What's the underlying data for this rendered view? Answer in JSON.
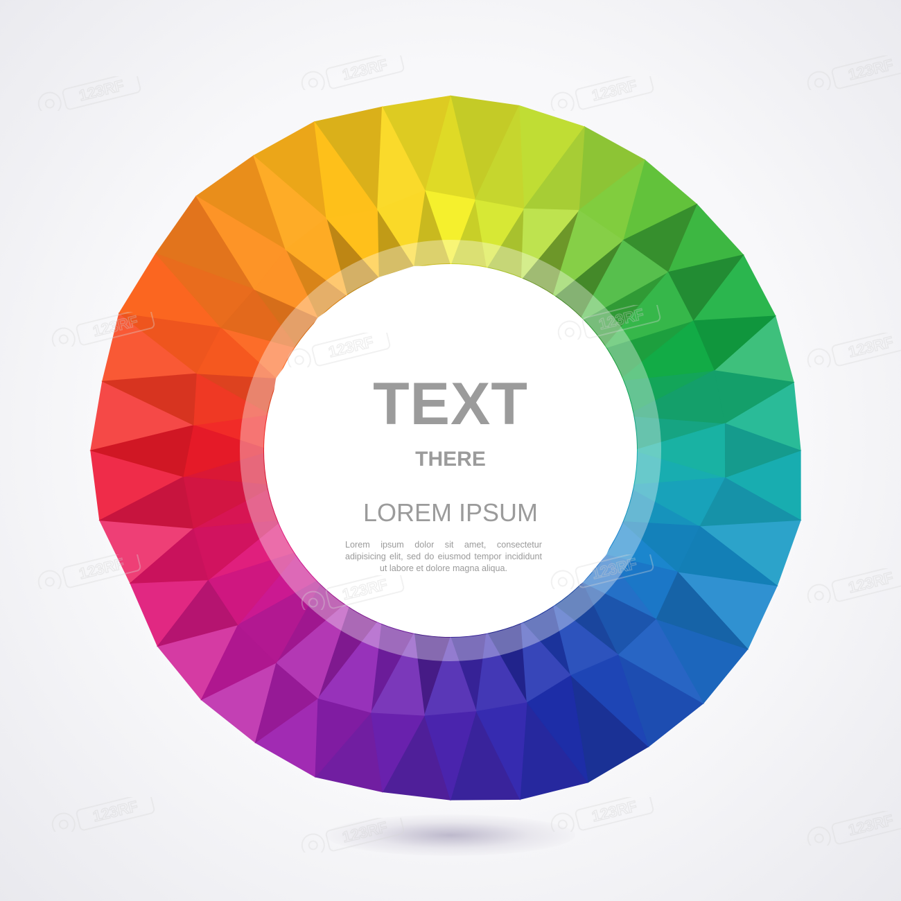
{
  "title": "TEXT",
  "subtitle": "THERE",
  "heading": "LOREM IPSUM",
  "body": "Lorem ipsum dolor sit amet, consectetur adipisicing elit, sed do eiusmod tempor incididunt ut labore et dolore magna aliqua.",
  "watermark_text": "123RF",
  "colors": {
    "text": "#9b9b9b",
    "background": "#f8f8fa",
    "spectrum": [
      "#f5f02a",
      "#b6e03a",
      "#45b83a",
      "#13b048",
      "#19b6a6",
      "#1690cf",
      "#1f5fc2",
      "#1f2fb0",
      "#4b25b0",
      "#8d1fb3",
      "#c51aa0",
      "#e8156a",
      "#f01b2a",
      "#fb5a20",
      "#fd8f1e",
      "#ffc01a"
    ]
  }
}
